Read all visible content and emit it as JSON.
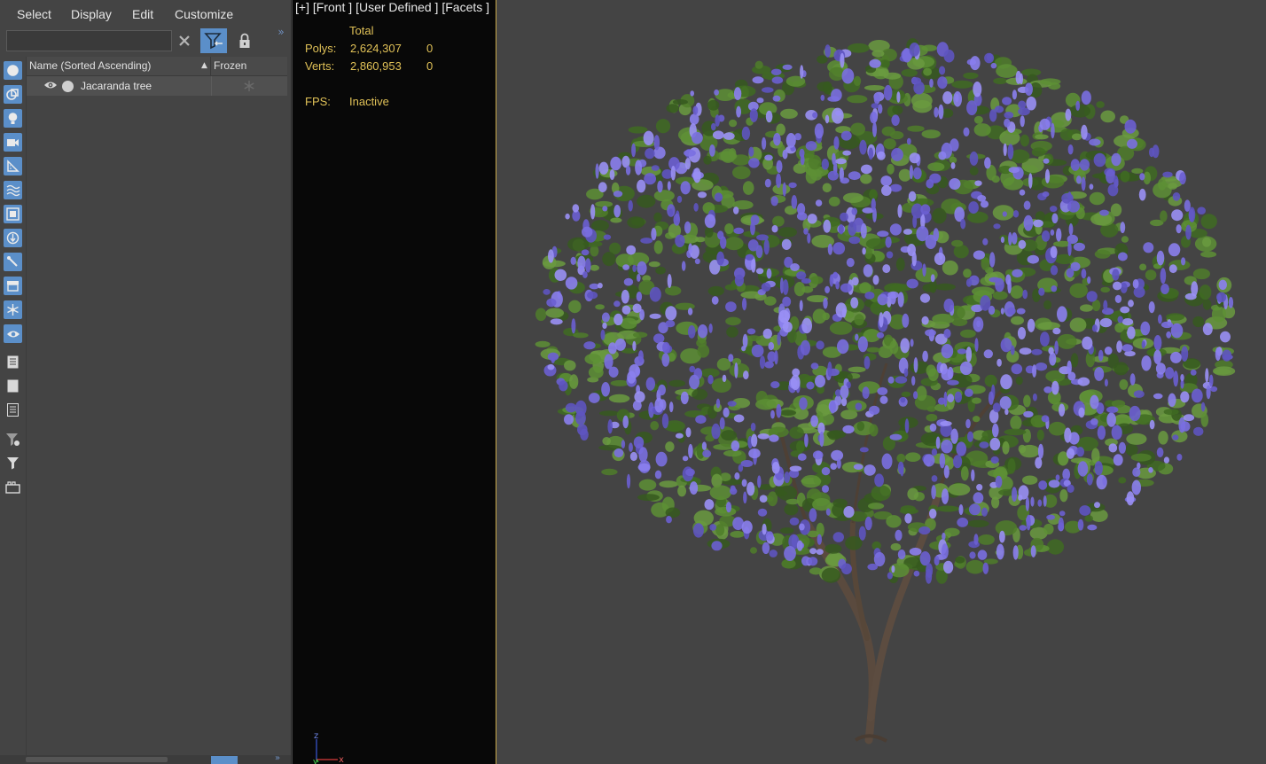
{
  "menu": {
    "select": "Select",
    "display": "Display",
    "edit": "Edit",
    "customize": "Customize"
  },
  "search": {
    "placeholder": ""
  },
  "toolbar": {
    "clear_icon": "close-icon",
    "filter_icon": "filter-icon",
    "lock_icon": "lock-icon",
    "expand_glyph": "»"
  },
  "side_toolbar": [
    "geometry-icon",
    "shapes-icon",
    "lights-icon",
    "cameras-icon",
    "helpers-icon",
    "space-warps-icon",
    "groups-icon",
    "xrefs-icon",
    "bones-icon",
    "containers-icon",
    "frozen-icon",
    "hidden-icon",
    "display-all-icon",
    "display-none-icon",
    "invert-display-icon",
    "filter-settings-icon",
    "filter-icon",
    "layers-icon"
  ],
  "columns": {
    "name": "Name (Sorted Ascending)",
    "sort_glyph": "▲",
    "frozen": "Frozen"
  },
  "rows": [
    {
      "name": "Jacaranda tree",
      "visible": true,
      "frozen": false
    }
  ],
  "viewport": {
    "label": "[+] [Front ] [User Defined ] [Facets ]",
    "stats": {
      "header": "Total",
      "polys_label": "Polys:",
      "polys_total": "2,624,307",
      "polys_selected": "0",
      "verts_label": "Verts:",
      "verts_total": "2,860,953",
      "verts_selected": "0",
      "fps_label": "FPS:",
      "fps_value": "Inactive"
    },
    "axis": {
      "z": "z",
      "y": "y",
      "x": "x"
    }
  },
  "colors": {
    "accent": "#5b8fc9",
    "stats_text": "#e0c157",
    "viewport_bg": "#444444",
    "foliage": "#4f7d2a",
    "flowers": "#7a6fe0"
  }
}
